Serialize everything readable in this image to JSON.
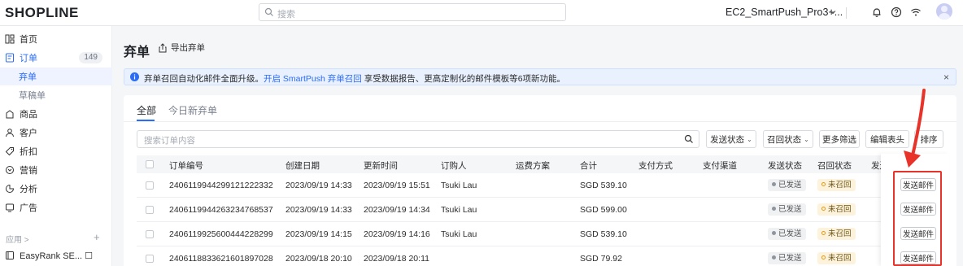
{
  "topbar": {
    "logo": "SHOPLINE",
    "search_placeholder": "搜索",
    "store_name": "EC2_SmartPush_Pro3+...",
    "icons": [
      "bell-icon",
      "help-icon",
      "wifi-icon",
      "avatar"
    ]
  },
  "sidebar": {
    "items": [
      {
        "label": "首页",
        "icon": "home-icon"
      },
      {
        "label": "订单",
        "icon": "order-icon",
        "badge": "149"
      },
      {
        "label": "弃单",
        "sub": true,
        "active": true
      },
      {
        "label": "草稿单",
        "sub": true
      },
      {
        "label": "商品",
        "icon": "product-icon"
      },
      {
        "label": "客户",
        "icon": "customer-icon"
      },
      {
        "label": "折扣",
        "icon": "discount-icon"
      },
      {
        "label": "营销",
        "icon": "marketing-icon"
      },
      {
        "label": "分析",
        "icon": "analytics-icon"
      },
      {
        "label": "广告",
        "icon": "ads-icon"
      }
    ],
    "apps_label": "应用 >",
    "apps_plus": "+",
    "app_item": "EasyRank SE... ☐"
  },
  "page": {
    "title": "弃单",
    "export_label": "导出弃单"
  },
  "banner": {
    "text_before": "弃单召回自动化邮件全面升级。",
    "link": "开启 SmartPush 弃单召回",
    "text_after": " 享受数据报告、更高定制化的邮件模板等6项新功能。",
    "close": "×"
  },
  "tabs": [
    {
      "label": "全部",
      "active": true
    },
    {
      "label": "今日新弃单",
      "active": false
    }
  ],
  "filters": {
    "search_placeholder": "搜索订单内容",
    "send_status": "发送状态",
    "recall_status": "召回状态",
    "more_filters": "更多筛选",
    "edit_columns": "编辑表头",
    "sort": "排序"
  },
  "table": {
    "columns": [
      "订单编号",
      "创建日期",
      "更新时间",
      "订购人",
      "运费方案",
      "合计",
      "支付方式",
      "支付渠道",
      "发送状态",
      "召回状态",
      "发送"
    ],
    "rows": [
      {
        "id": "2406119944299121222332",
        "created": "2023/09/19 14:33",
        "updated": "2023/09/19 15:51",
        "buyer": "Tsuki Lau",
        "total": "SGD 539.10",
        "send_status": "已发送",
        "recall_status": "未召回",
        "action": "发送邮件"
      },
      {
        "id": "2406119944263234768537",
        "created": "2023/09/19 14:33",
        "updated": "2023/09/19 14:34",
        "buyer": "Tsuki Lau",
        "total": "SGD 599.00",
        "send_status": "已发送",
        "recall_status": "未召回",
        "action": "发送邮件"
      },
      {
        "id": "2406119925600444228299",
        "created": "2023/09/19 14:15",
        "updated": "2023/09/19 14:16",
        "buyer": "Tsuki Lau",
        "total": "SGD 539.10",
        "send_status": "已发送",
        "recall_status": "未召回",
        "action": "发送邮件"
      },
      {
        "id": "2406118833621601897028",
        "created": "2023/09/18 20:10",
        "updated": "2023/09/18 20:11",
        "buyer": "",
        "total": "SGD 79.92",
        "send_status": "已发送",
        "recall_status": "未召回",
        "action": "发送邮件"
      }
    ]
  },
  "colors": {
    "accent": "#2b6cf6",
    "annotation_red": "#e8332a",
    "warning_ring": "#e29a13"
  }
}
